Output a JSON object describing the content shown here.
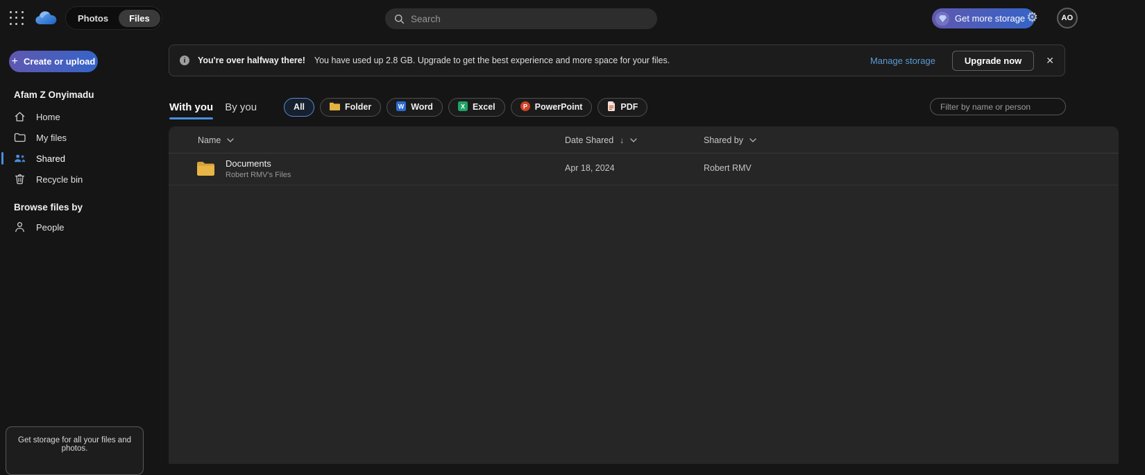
{
  "topbar": {
    "toggle": {
      "photos": "Photos",
      "files": "Files"
    },
    "search_placeholder": "Search",
    "get_more_storage_label": "Get more storage",
    "avatar_initials": "AO",
    "gear_glyph": "⚙"
  },
  "banner": {
    "info_glyph": "i",
    "title": "You're over halfway there!",
    "message": "You have used up 2.8 GB. Upgrade to get the best experience and more space for your files.",
    "manage_link": "Manage storage",
    "upgrade_button": "Upgrade now",
    "close_glyph": "✕"
  },
  "sidebar": {
    "create_button": "Create or upload",
    "plus_glyph": "+",
    "owner_name": "Afam Z Onyimadu",
    "items": [
      {
        "label": "Home",
        "icon": "home-icon",
        "selected": false
      },
      {
        "label": "My files",
        "icon": "folder-icon",
        "selected": false
      },
      {
        "label": "Shared",
        "icon": "people-icon",
        "selected": true
      },
      {
        "label": "Recycle bin",
        "icon": "trash-icon",
        "selected": false
      }
    ],
    "browse_header": "Browse files by",
    "people_item": "People"
  },
  "filters": {
    "tabs": [
      {
        "label": "With you",
        "selected": true
      },
      {
        "label": "By you",
        "selected": false
      }
    ],
    "pills": [
      {
        "label": "All",
        "icon": "none",
        "selected": true
      },
      {
        "label": "Folder",
        "icon": "folder-icon",
        "selected": false
      },
      {
        "label": "Word",
        "icon": "word-icon",
        "selected": false
      },
      {
        "label": "Excel",
        "icon": "excel-icon",
        "selected": false
      },
      {
        "label": "PowerPoint",
        "icon": "powerpoint-icon",
        "selected": false
      },
      {
        "label": "PDF",
        "icon": "pdf-icon",
        "selected": false
      }
    ],
    "filter_placeholder": "Filter by name or person"
  },
  "table": {
    "columns": [
      "Name",
      "Date Shared",
      "Shared by"
    ],
    "sort_glyph": "↓",
    "rows": [
      {
        "name": "Documents",
        "subtitle": "Robert RMV's Files",
        "date_shared": "Apr 18, 2024",
        "shared_by": "Robert RMV"
      }
    ]
  },
  "promo": {
    "text": "Get storage for all your files and photos."
  },
  "colors": {
    "accent_blue": "#4a8fe0",
    "link_blue": "#5b9bd5",
    "premium_gradient_start": "#5f58b0",
    "premium_gradient_end": "#3564c8",
    "folder_yellow": "#e3b341",
    "word_blue": "#2b6bd0",
    "excel_green": "#21a366",
    "powerpoint_red": "#d04423",
    "pdf_red": "#d65532"
  }
}
